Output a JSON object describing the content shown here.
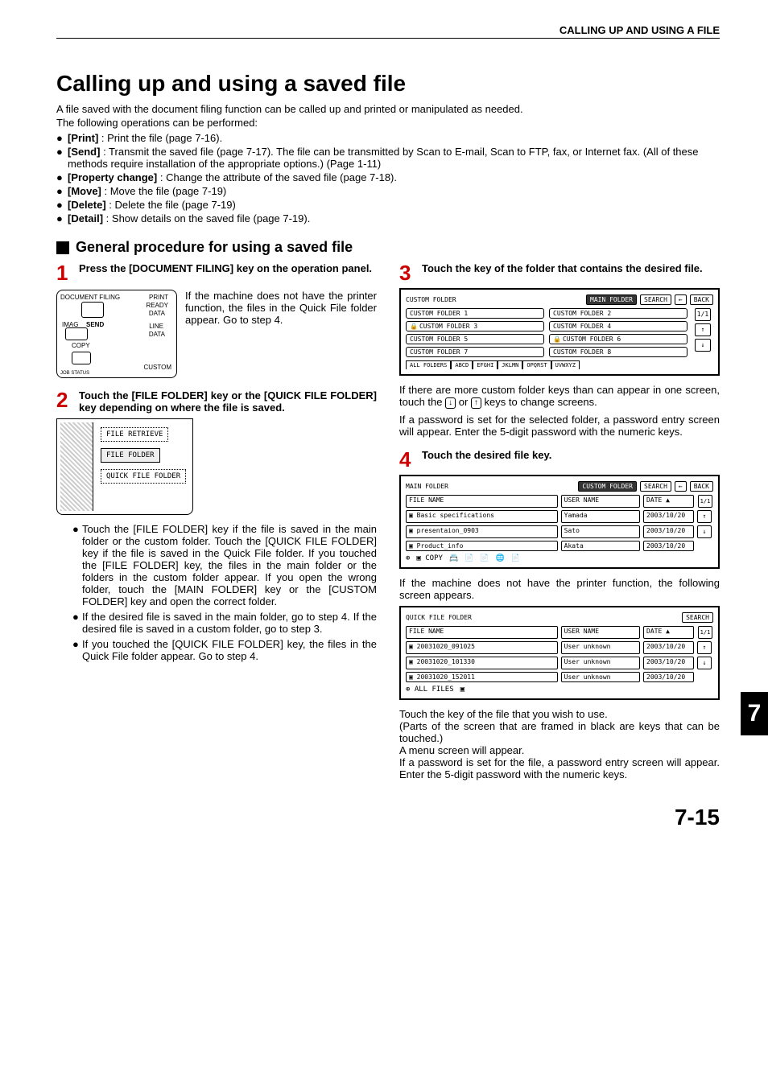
{
  "header": "CALLING UP AND USING A FILE",
  "title": "Calling up and using a saved file",
  "intro1": "A file saved with the document filing function can be called up and printed or manipulated as needed.",
  "intro2": "The following operations can be performed:",
  "bullets": [
    "[Print] : Print the file (page 7-16).",
    "[Send] : Transmit the saved file (page 7-17). The file can be transmitted by Scan to E-mail, Scan to FTP, fax, or Internet fax. (All of these methods require installation of the appropriate options.) (Page 1-11)",
    "[Property change] : Change the attribute of the saved file (page 7-18).",
    "[Move] : Move the file (page 7-19)",
    "[Delete] : Delete the file (page 7-19)",
    "[Detail] : Show details on the saved file (page 7-19)."
  ],
  "subheading": "General procedure for using a saved file",
  "steps": {
    "s1": {
      "num": "1",
      "title": "Press the [DOCUMENT FILING] key on the operation panel.",
      "panel_text": "If the machine does not have the printer function, the files in the Quick File folder appear. Go to step 4.",
      "panel_labels": {
        "dfiling": "DOCUMENT FILING",
        "print": "PRINT",
        "ready": "READY",
        "data1": "DATA",
        "imag": "IMAG",
        "send": "SEND",
        "line": "LINE",
        "data2": "DATA",
        "copy": "COPY",
        "custom": "CUSTOM",
        "jobstatus": "JOB STATUS"
      }
    },
    "s2": {
      "num": "2",
      "title": "Touch the [FILE FOLDER] key or the [QUICK FILE FOLDER] key depending on where the file is saved.",
      "draw": {
        "t1": "FILE RETRIEVE",
        "t2": "FILE FOLDER",
        "t3": "QUICK FILE FOLDER"
      },
      "ul": [
        "Touch the [FILE FOLDER] key if the file is saved in the main folder or the custom folder. Touch the [QUICK FILE FOLDER] key if the file is saved in the Quick File folder.\nIf you touched the [FILE FOLDER] key, the files in the main folder or the folders in the custom folder appear. If you open the wrong folder, touch the [MAIN FOLDER] key or the [CUSTOM FOLDER] key and open the correct folder.",
        "If the desired file is saved in the main folder, go to step 4. If the desired file is saved in a custom folder, go to step 3.",
        "If you touched the [QUICK FILE FOLDER] key, the files in the Quick File folder appear. Go to step 4."
      ]
    },
    "s3": {
      "num": "3",
      "title": "Touch the key of the folder that contains the desired file.",
      "screen": {
        "title": "CUSTOM FOLDER",
        "topbtns": [
          "MAIN FOLDER",
          "SEARCH",
          "←",
          "BACK"
        ],
        "folders": [
          "CUSTOM FOLDER 1",
          "CUSTOM FOLDER 2",
          "CUSTOM FOLDER 3",
          "CUSTOM FOLDER 4",
          "CUSTOM FOLDER 5",
          "CUSTOM FOLDER 6",
          "CUSTOM FOLDER 7",
          "CUSTOM FOLDER 8"
        ],
        "locked": [
          2,
          5
        ],
        "page": "1/1",
        "tabs": [
          "ALL FOLDERS",
          "ABCD",
          "EFGHI",
          "JKLMN",
          "OPQRST",
          "UVWXYZ"
        ]
      },
      "after1a": "If there are more custom folder keys than can appear in one screen, touch the ",
      "after1b": " or ",
      "after1c": " keys to change screens.",
      "after2": "If a password is set for the selected folder, a password entry screen will appear. Enter the 5-digit password with the numeric keys."
    },
    "s4": {
      "num": "4",
      "title": "Touch the desired file key.",
      "screenA": {
        "title": "MAIN FOLDER",
        "topbtns": [
          "CUSTOM FOLDER",
          "SEARCH",
          "←",
          "BACK"
        ],
        "cols": [
          "FILE NAME",
          "USER NAME",
          "DATE   ▲"
        ],
        "rows": [
          [
            "Basic specifications",
            "Yamada",
            "2003/10/20"
          ],
          [
            "presentaion_0903",
            "Sato",
            "2003/10/20"
          ],
          [
            "Product_info",
            "Akata",
            "2003/10/20"
          ]
        ],
        "page": "1/1"
      },
      "mid": "If the machine does not have the printer function, the following screen appears.",
      "screenB": {
        "title": "QUICK FILE FOLDER",
        "topbtns": [
          "SEARCH"
        ],
        "cols": [
          "FILE NAME",
          "USER NAME",
          "DATE   ▲"
        ],
        "rows": [
          [
            "20031020_091025",
            "User unknown",
            "2003/10/20"
          ],
          [
            "20031020_101330",
            "User unknown",
            "2003/10/20"
          ],
          [
            "20031020_152011",
            "User unknown",
            "2003/10/20"
          ]
        ],
        "bottom": "ALL FILES",
        "page": "1/1"
      },
      "after": [
        "Touch the key of the file that you wish to use.",
        "(Parts of the screen that are framed in black are keys that can be touched.)",
        "A menu screen will appear.",
        "If a password is set for the file, a password entry screen will appear. Enter the 5-digit password with the numeric keys."
      ]
    }
  },
  "sidetab": "7",
  "footer": "7-15"
}
